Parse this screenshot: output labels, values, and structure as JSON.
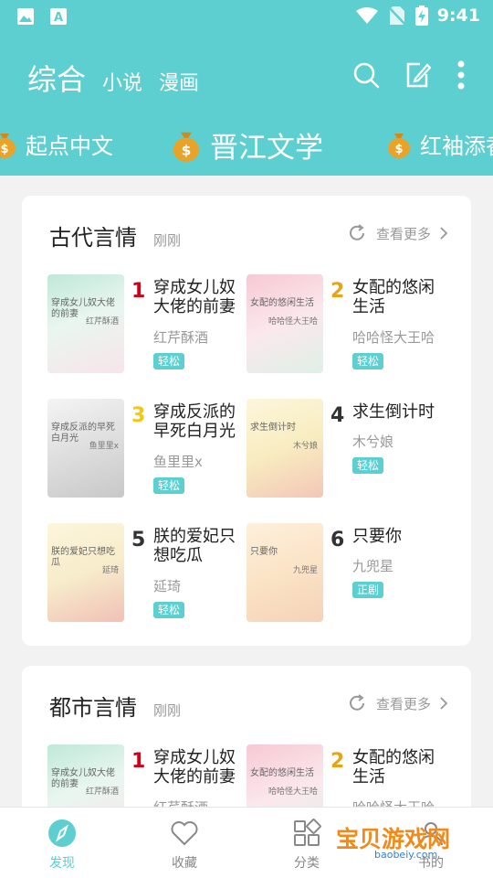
{
  "status_bar": {
    "time": "9:41"
  },
  "header": {
    "tabs": [
      {
        "label": "综合"
      },
      {
        "label": "小说"
      },
      {
        "label": "漫画"
      }
    ]
  },
  "marquee": [
    {
      "label": "起点中文"
    },
    {
      "label": "晋江文学"
    },
    {
      "label": "红袖添香"
    }
  ],
  "sections": [
    {
      "title": "古代言情",
      "time": "刚刚",
      "more_label": "查看更多",
      "books": [
        {
          "rank": "1",
          "title": "穿成女儿奴大佬的前妻",
          "author": "红芹酥酒",
          "tag": "轻松",
          "cover_title": "穿成女儿奴大佬的前妻",
          "cover_author": "红芹酥酒",
          "rank_color": "#d0021b"
        },
        {
          "rank": "2",
          "title": "女配的悠闲生活",
          "author": "哈哈怪大王哈",
          "tag": "轻松",
          "cover_title": "女配的悠闲生活",
          "cover_author": "哈哈怪大王哈",
          "rank_color": "#e8a317"
        },
        {
          "rank": "3",
          "title": "穿成反派的早死白月光",
          "author": "鱼里里x",
          "tag": "轻松",
          "cover_title": "穿成反派的早死白月光",
          "cover_author": "鱼里里x",
          "rank_color": "#f5c518"
        },
        {
          "rank": "4",
          "title": "求生倒计时",
          "author": "木兮娘",
          "tag": "轻松",
          "cover_title": "求生倒计时",
          "cover_author": "木兮娘",
          "rank_color": "#333333"
        },
        {
          "rank": "5",
          "title": "朕的爱妃只想吃瓜",
          "author": "延琦",
          "tag": "轻松",
          "cover_title": "朕的爱妃只想吃瓜",
          "cover_author": "延琦",
          "rank_color": "#333333"
        },
        {
          "rank": "6",
          "title": "只要你",
          "author": "九兜星",
          "tag": "正剧",
          "cover_title": "只要你",
          "cover_author": "九兜星",
          "rank_color": "#333333"
        }
      ]
    },
    {
      "title": "都市言情",
      "time": "刚刚",
      "more_label": "查看更多",
      "books": [
        {
          "rank": "1",
          "title": "穿成女儿奴大佬的前妻",
          "author": "红芹酥酒",
          "cover_title": "穿成女儿奴大佬的前妻",
          "cover_author": "红芹酥酒",
          "rank_color": "#d0021b"
        },
        {
          "rank": "2",
          "title": "女配的悠闲生活",
          "author": "哈哈怪大王哈",
          "cover_title": "女配的悠闲生活",
          "cover_author": "哈哈怪大王哈",
          "rank_color": "#e8a317"
        }
      ]
    }
  ],
  "bottom_nav": [
    {
      "label": "发现",
      "icon": "compass-icon"
    },
    {
      "label": "收藏",
      "icon": "heart-icon"
    },
    {
      "label": "分类",
      "icon": "grid-icon"
    },
    {
      "label": "书的",
      "icon": "user-icon"
    }
  ],
  "watermark": {
    "text": "宝贝游戏网",
    "url": "baobeiy.com"
  },
  "colors": {
    "accent": "#5dcfd0",
    "page_bg": "#f2f2f2"
  }
}
